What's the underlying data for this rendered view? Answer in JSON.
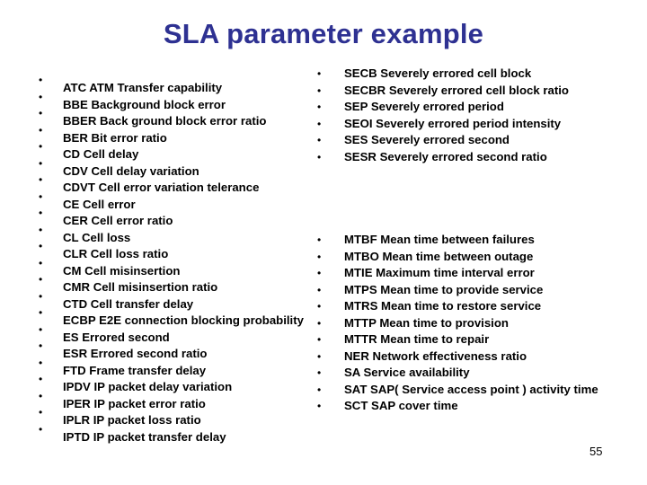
{
  "slide": {
    "title": "SLA parameter example",
    "page_number": "55",
    "bullet_glyph": "•",
    "left_column": [
      {
        "abbr": "ATC",
        "text": "ATC  ATM Transfer capability"
      },
      {
        "abbr": "BBE",
        "text": "BBE  Background block error"
      },
      {
        "abbr": "BBER",
        "text": "BBER  Back ground block error ratio"
      },
      {
        "abbr": "BER",
        "text": "BER   Bit error ratio"
      },
      {
        "abbr": "CD",
        "text": "CD  Cell delay"
      },
      {
        "abbr": "CDV",
        "text": "CDV   Cell delay variation"
      },
      {
        "abbr": "CDVT",
        "text": "CDVT   Cell error variation telerance"
      },
      {
        "abbr": "CE",
        "text": "CE   Cell error"
      },
      {
        "abbr": "CER",
        "text": "CER   Cell error ratio"
      },
      {
        "abbr": "CL",
        "text": "CL  Cell loss"
      },
      {
        "abbr": "CLR",
        "text": "CLR  Cell loss ratio"
      },
      {
        "abbr": "CM",
        "text": "CM   Cell misinsertion"
      },
      {
        "abbr": "CMR",
        "text": "CMR   Cell misinsertion ratio"
      },
      {
        "abbr": "CTD",
        "text": "CTD  Cell transfer delay"
      },
      {
        "abbr": "ECBP",
        "text": "ECBP  E2E connection blocking probability"
      },
      {
        "abbr": "ES",
        "text": "ES  Errored second"
      },
      {
        "abbr": "ESR",
        "text": "ESR   Errored second ratio"
      },
      {
        "abbr": "FTD",
        "text": "FTD  Frame transfer delay"
      },
      {
        "abbr": "IPDV",
        "text": "IPDV   IP packet delay variation"
      },
      {
        "abbr": "IPER",
        "text": "IPER  IP packet error ratio"
      },
      {
        "abbr": "IPLR",
        "text": "IPLR  IP packet loss ratio"
      },
      {
        "abbr": "IPTD",
        "text": "IPTD   IP packet transfer delay"
      }
    ],
    "right_column_top": [
      {
        "abbr": "SECB",
        "text": "SECB   Severely errored cell block"
      },
      {
        "abbr": "SECBR",
        "text": "SECBR   Severely errored  cell block ratio"
      },
      {
        "abbr": "SEP",
        "text": "SEP   Severely errored period"
      },
      {
        "abbr": "SEOI",
        "text": "SEOI   Severely errored  period intensity"
      },
      {
        "abbr": "SES",
        "text": "SES   Severely errored second"
      },
      {
        "abbr": "SESR",
        "text": "SESR   Severely errored second ratio"
      }
    ],
    "right_column_bottom": [
      {
        "abbr": "MTBF",
        "text": "MTBF  Mean time between failures"
      },
      {
        "abbr": "MTBO",
        "text": "MTBO   Mean time between outage"
      },
      {
        "abbr": "MTIE",
        "text": "MTIE   Maximum time interval error"
      },
      {
        "abbr": "MTPS",
        "text": "MTPS   Mean time to provide service"
      },
      {
        "abbr": "MTRS",
        "text": "MTRS   Mean time to restore service"
      },
      {
        "abbr": "MTTP",
        "text": "MTTP   Mean time to provision"
      },
      {
        "abbr": "MTTR",
        "text": "MTTR   Mean time to repair"
      },
      {
        "abbr": "NER",
        "text": "NER   Network effectiveness ratio"
      },
      {
        "abbr": "SA",
        "text": "SA  Service availability"
      },
      {
        "abbr": "SAT",
        "text": "SAT   SAP( Service access point ) activity time"
      },
      {
        "abbr": "SCT",
        "text": "SCT   SAP cover time"
      }
    ],
    "colors": {
      "title": "#2e3192",
      "body_text": "#000000",
      "background": "#ffffff"
    }
  }
}
